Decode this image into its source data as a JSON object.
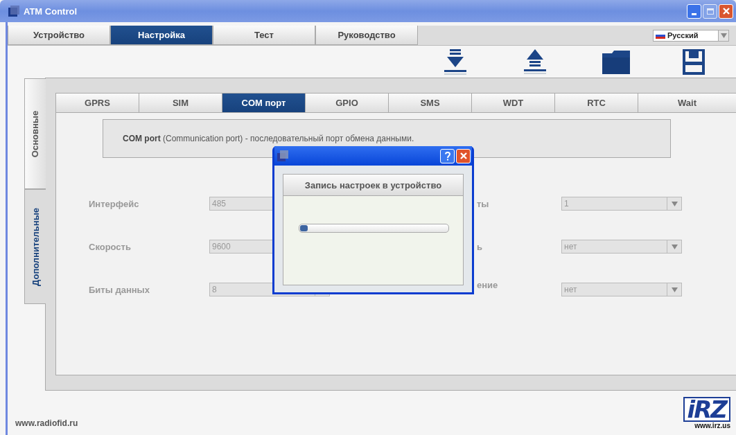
{
  "window": {
    "title": "ATM Control"
  },
  "main_tabs": [
    {
      "label": "Устройство",
      "selected": false
    },
    {
      "label": "Настройка",
      "selected": true
    },
    {
      "label": "Тест",
      "selected": false
    },
    {
      "label": "Руководство",
      "selected": false
    }
  ],
  "language": {
    "value": "Русский"
  },
  "side_tabs": [
    {
      "label": "Основные",
      "selected": false
    },
    {
      "label": "Дополнительные",
      "selected": true
    }
  ],
  "sub_tabs": [
    {
      "label": "GPRS",
      "selected": false
    },
    {
      "label": "SIM",
      "selected": false
    },
    {
      "label": "COM порт",
      "selected": true
    },
    {
      "label": "GPIO",
      "selected": false
    },
    {
      "label": "SMS",
      "selected": false
    },
    {
      "label": "WDT",
      "selected": false
    },
    {
      "label": "RTC",
      "selected": false
    },
    {
      "label": "Wait",
      "selected": false
    }
  ],
  "info": "**COM port** (Communication port) - последовательный порт обмена данными.",
  "left_fields": [
    {
      "label": "Интерфейс",
      "value": "485"
    },
    {
      "label": "Скорость",
      "value": "9600"
    },
    {
      "label": "Биты данных",
      "value": "8"
    }
  ],
  "right_fields": [
    {
      "label": "ты",
      "value": "1"
    },
    {
      "label": "ь",
      "value": "нет"
    },
    {
      "label": "ение",
      "value": "нет"
    }
  ],
  "dialog": {
    "heading": "Запись настроек в устройство",
    "level": 0.05
  },
  "footer": {
    "link": "www.radiofid.ru",
    "logo": "iRZ",
    "logo_url": "www.irz.us"
  }
}
